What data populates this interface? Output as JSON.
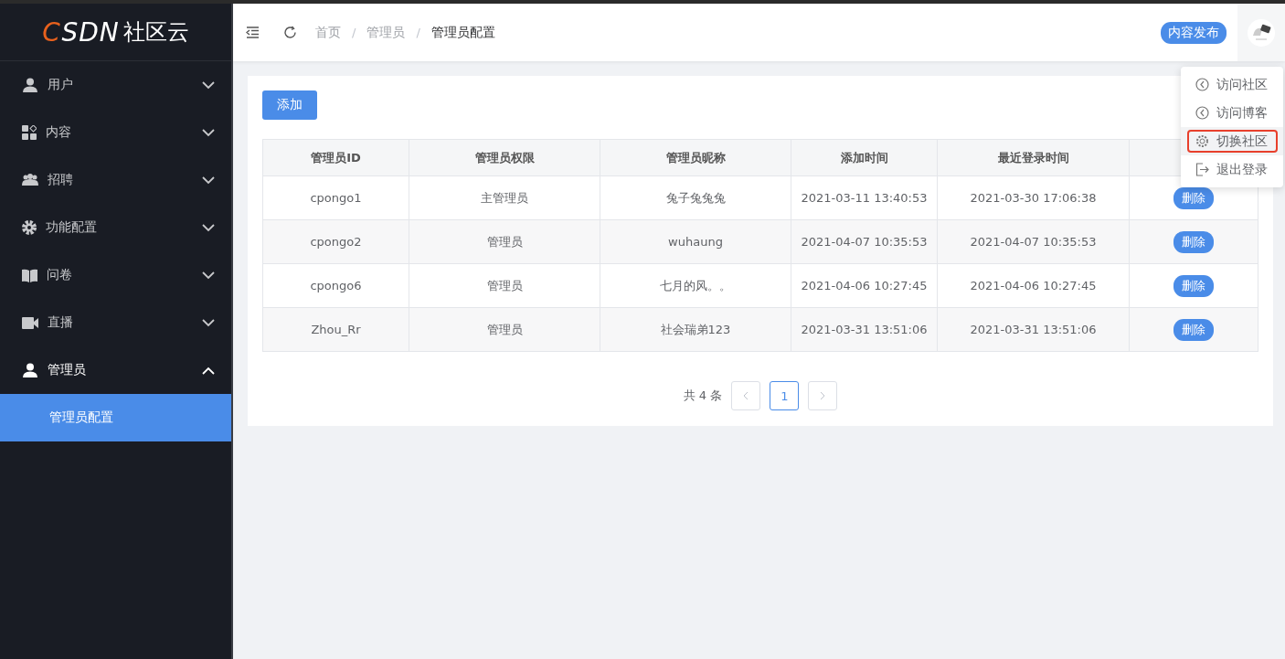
{
  "logo": {
    "accent": "C",
    "rest": "SDN",
    "suffix": "社区云"
  },
  "sidebar": {
    "items": [
      {
        "label": "用户",
        "expanded": false
      },
      {
        "label": "内容",
        "expanded": false
      },
      {
        "label": "招聘",
        "expanded": false
      },
      {
        "label": "功能配置",
        "expanded": false
      },
      {
        "label": "问卷",
        "expanded": false
      },
      {
        "label": "直播",
        "expanded": false
      },
      {
        "label": "管理员",
        "expanded": true,
        "children": [
          {
            "label": "管理员配置",
            "selected": true
          }
        ]
      }
    ]
  },
  "header": {
    "breadcrumbs": [
      "首页",
      "管理员",
      "管理员配置"
    ],
    "breadcrumb_separator": "/",
    "publish_button": "内容发布"
  },
  "user_menu": {
    "items": [
      {
        "label": "访问社区",
        "selected": false
      },
      {
        "label": "访问博客",
        "selected": false
      },
      {
        "label": "切换社区",
        "selected": true
      },
      {
        "label": "退出登录",
        "selected": false
      }
    ]
  },
  "add_button": "添加",
  "table": {
    "columns": [
      "管理员ID",
      "管理员权限",
      "管理员昵称",
      "添加时间",
      "最近登录时间"
    ],
    "rows": [
      {
        "cells": [
          "cpongo1",
          "主管理员",
          "兔子兔兔兔",
          "2021-03-11 13:40:53",
          "2021-03-30 17:06:38"
        ],
        "action": "删除"
      },
      {
        "cells": [
          "cpongo2",
          "管理员",
          "wuhaung",
          "2021-04-07 10:35:53",
          "2021-04-07 10:35:53"
        ],
        "action": "删除"
      },
      {
        "cells": [
          "cpongo6",
          "管理员",
          "七月的风。。",
          "2021-04-06 10:27:45",
          "2021-04-06 10:27:45"
        ],
        "action": "删除"
      },
      {
        "cells": [
          "Zhou_Rr",
          "管理员",
          "社会瑞弟123",
          "2021-03-31 13:51:06",
          "2021-03-31 13:51:06"
        ],
        "action": "删除"
      }
    ]
  },
  "pagination": {
    "total": "共 4 条",
    "pages": [
      {
        "label": "1",
        "selected": true
      }
    ]
  }
}
